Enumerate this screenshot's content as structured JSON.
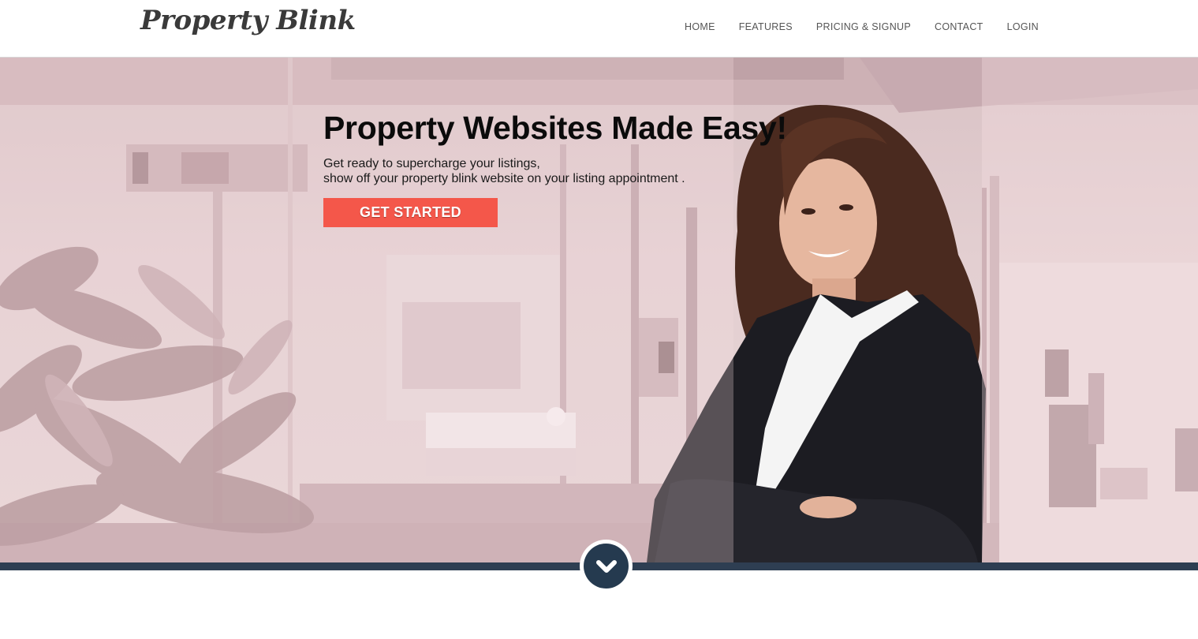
{
  "header": {
    "logo_text": "Property Blink",
    "nav": [
      {
        "label": "HOME"
      },
      {
        "label": "FEATURES"
      },
      {
        "label": "PRICING & SIGNUP"
      },
      {
        "label": "CONTACT"
      },
      {
        "label": "LOGIN"
      }
    ]
  },
  "hero": {
    "title": "Property Websites Made Easy!",
    "subtitle_line1": "Get ready to supercharge your listings,",
    "subtitle_line2": "show off your property blink website on your listing appointment .",
    "cta_label": "GET STARTED"
  },
  "scroll_down": {
    "icon": "chevron-down-icon"
  },
  "colors": {
    "accent": "#f4574a",
    "strip": "#2e3e52",
    "scroll_button": "#253a4f"
  }
}
